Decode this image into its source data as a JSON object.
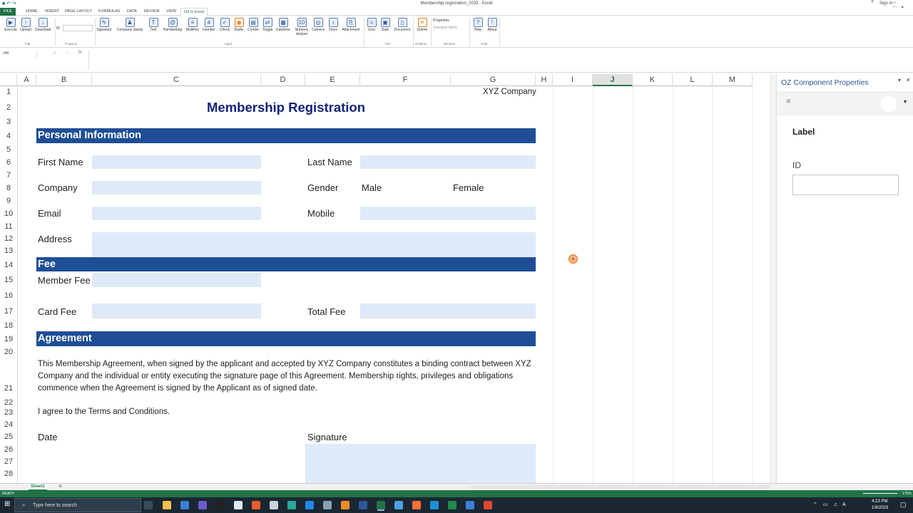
{
  "window": {
    "title": "Membership registration_2023 - Excel",
    "sign_in": "Sign in"
  },
  "tabs": [
    "FILE",
    "HOME",
    "INSERT",
    "PAGE LAYOUT",
    "FORMULAS",
    "DATA",
    "REVIEW",
    "VIEW",
    "OZ in Excel"
  ],
  "ribbon": {
    "file_buttons": [
      "Execute",
      "Upload",
      "Download"
    ],
    "property_label": "ID",
    "input_buttons": [
      "Signature",
      "Company stamp",
      "Text",
      "Handwriting",
      "Multiline",
      "Number",
      "Check",
      "Radio",
      "Combo",
      "Toggle",
      "Datetime",
      "Numeric stepper",
      "Camera",
      "Voice",
      "Attachment"
    ],
    "info_buttons": [
      "User",
      "Date",
      "Document"
    ],
    "deletion_buttons": [
      "Delete"
    ],
    "window_items": [
      "Properties",
      "Standard Items"
    ],
    "help_buttons": [
      "Help",
      "About"
    ],
    "groups": [
      "File",
      "Property",
      "Input",
      "Info",
      "Deletion",
      "Window",
      "Help"
    ]
  },
  "formula_bar": {
    "name_box": "J48",
    "fx": "fx"
  },
  "columns": [
    "A",
    "B",
    "C",
    "D",
    "E",
    "F",
    "G",
    "H",
    "I",
    "J",
    "K",
    "L",
    "M"
  ],
  "selected_column": "J",
  "rows": [
    "1",
    "2",
    "3",
    "4",
    "5",
    "6",
    "7",
    "8",
    "9",
    "10",
    "11",
    "12",
    "13",
    "14",
    "15",
    "16",
    "17",
    "18",
    "19",
    "20",
    "21",
    "22",
    "23",
    "24",
    "25",
    "26",
    "27",
    "28"
  ],
  "form": {
    "company": "XYZ Company",
    "title": "Membership Registration",
    "sections": {
      "personal": "Personal Information",
      "fee": "Fee",
      "agreement": "Agreement"
    },
    "labels": {
      "first_name": "First Name",
      "last_name": "Last Name",
      "company": "Company",
      "gender": "Gender",
      "male": "Male",
      "female": "Female",
      "email": "Email",
      "mobile": "Mobile",
      "address": "Address",
      "member_fee": "Member Fee",
      "card_fee": "Card Fee",
      "total_fee": "Total Fee",
      "date": "Date",
      "signature": "Signature"
    },
    "agreement_text": "This Membership Agreement, when signed by the applicant and accepted by XYZ Company constitutes a binding contract between XYZ Company and the individual or entity executing the signature page of this Agreement. Membership rights, privileges and obligations commence when the Agreement is signed by the Applicant as of signed date.",
    "terms": "I agree to the Terms and Conditions."
  },
  "panel": {
    "title": "OZ Component Properties",
    "label": "Label",
    "id_label": "ID",
    "id_value": ""
  },
  "sheet_tab": "Sheet1",
  "status": {
    "ready": "READY",
    "zoom": "175%"
  },
  "taskbar": {
    "search_placeholder": "Type here to search",
    "time": "4:23 PM",
    "date": "1/9/2023"
  },
  "colors": {
    "excel_green": "#217346",
    "section_blue": "#1f4e96",
    "title_navy": "#12237a",
    "field_fill": "#deeaf7"
  }
}
